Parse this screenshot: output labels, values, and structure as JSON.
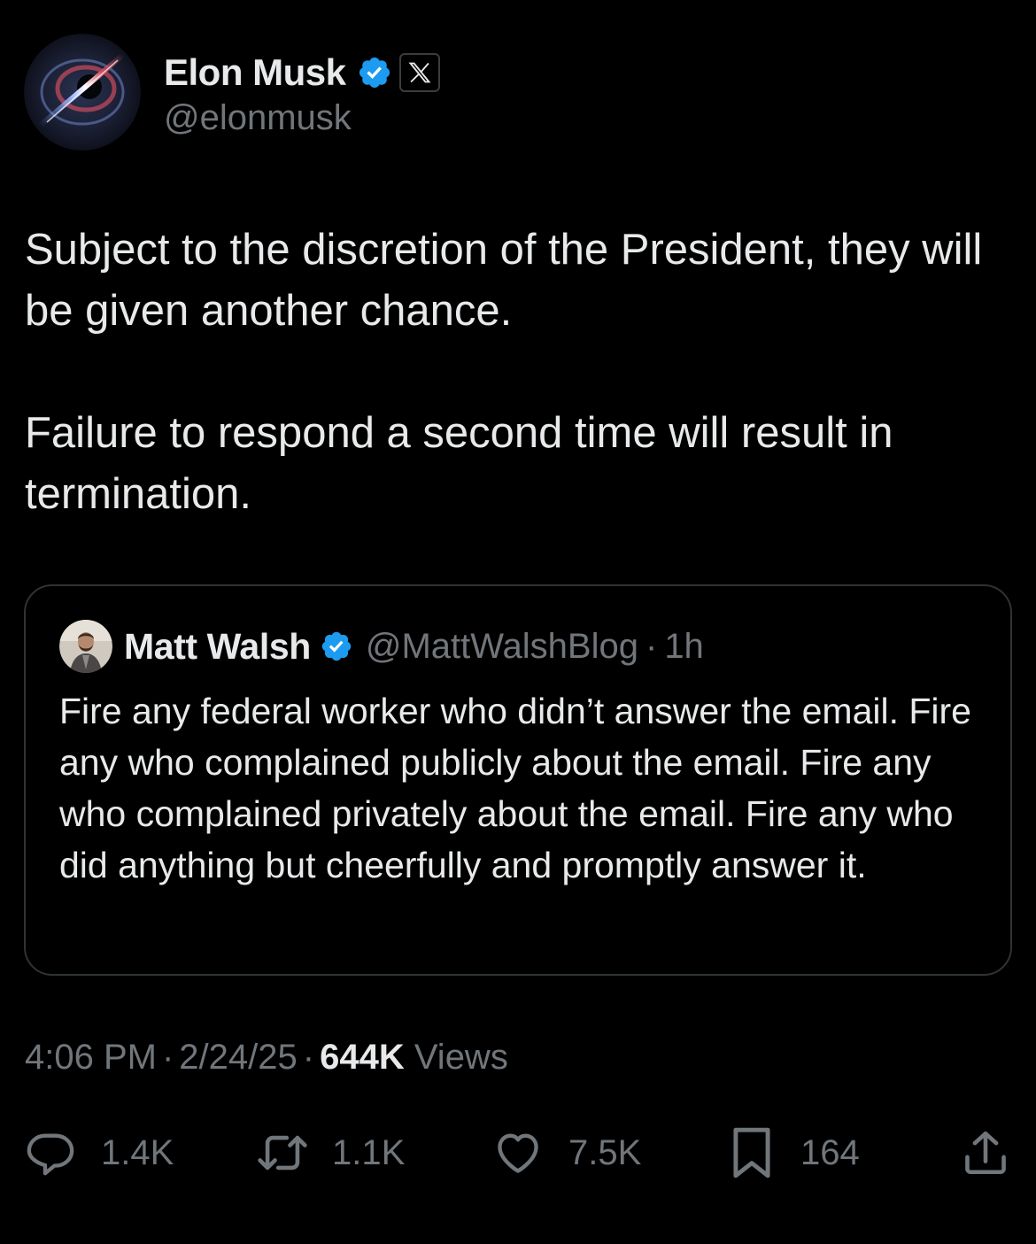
{
  "tweet": {
    "author": {
      "name": "Elon Musk",
      "handle": "@elonmusk",
      "verified_icon": "verified-badge-icon",
      "affiliation_icon": "x-logo-icon"
    },
    "text": [
      "Subject to the discretion of the President, they will be given another chance.",
      "Failure to respond a second time will result in termination."
    ],
    "quote": {
      "name": "Matt Walsh",
      "handle": "@MattWalshBlog",
      "dot": "·",
      "time": "1h",
      "text": "Fire any federal worker who didn’t answer the email. Fire any who complained publicly about the email. Fire any who complained privately about the email. Fire any who did anything but cheerfully and promptly answer it."
    },
    "meta": {
      "time": "4:06 PM",
      "date": "2/24/25",
      "views_count": "644K",
      "views_label": "Views",
      "sep": "·"
    },
    "actions": {
      "replies": "1.4K",
      "reposts": "1.1K",
      "likes": "7.5K",
      "bookmarks": "164"
    }
  },
  "colors": {
    "background": "#000000",
    "text_primary": "#e7e9ea",
    "text_secondary": "#71767b",
    "border": "#2f3336",
    "verified_blue": "#1d9bf0"
  }
}
